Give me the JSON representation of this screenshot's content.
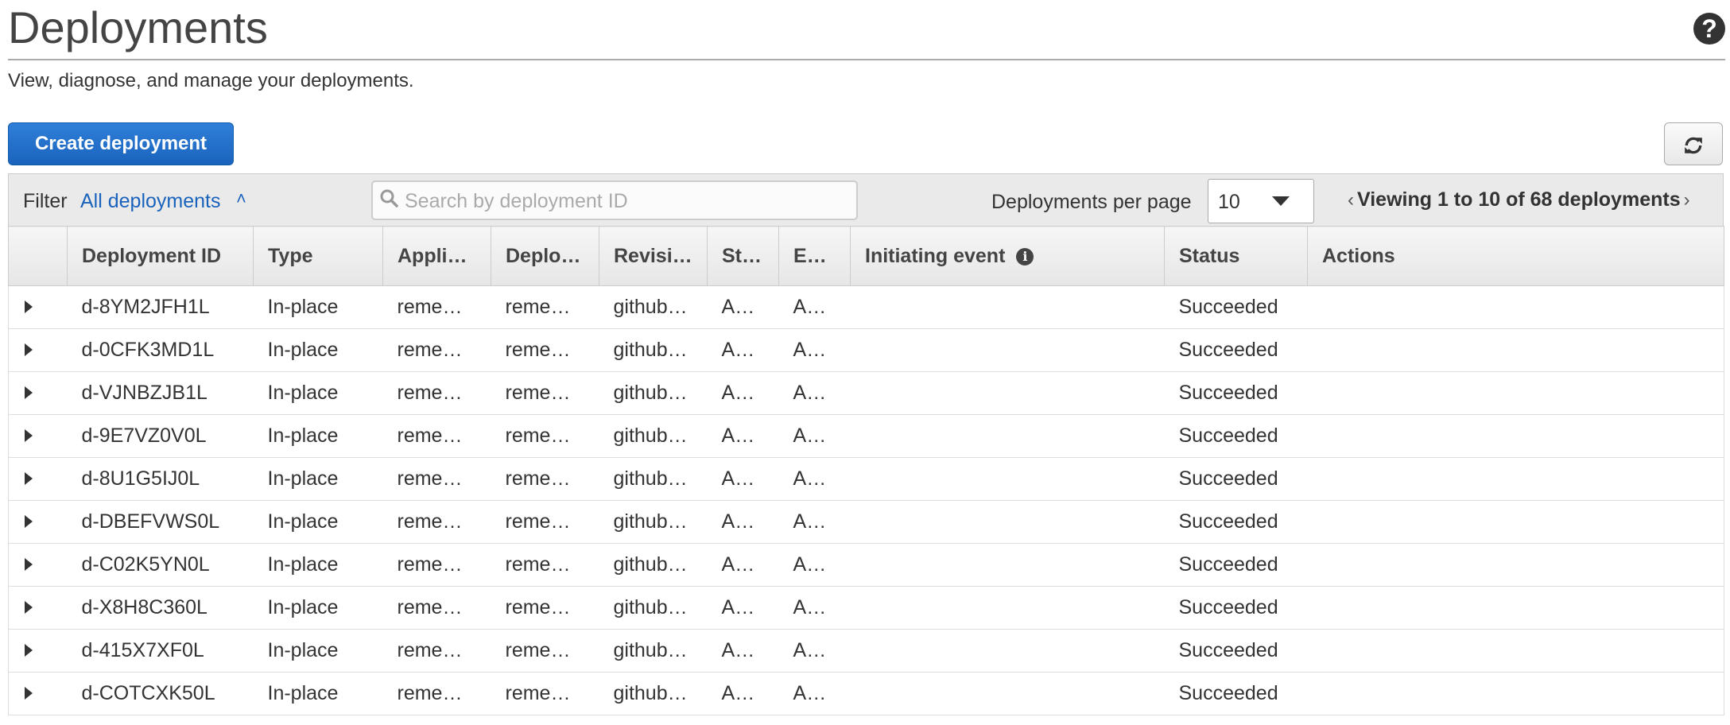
{
  "header": {
    "title": "Deployments",
    "subtitle": "View, diagnose, and manage your deployments.",
    "help_icon": "question-circle-icon"
  },
  "toolbar": {
    "create_label": "Create deployment",
    "refresh_icon": "refresh-icon"
  },
  "filter": {
    "label": "Filter",
    "value": "All deployments",
    "search_placeholder": "Search by deployment ID",
    "per_page_label": "Deployments per page",
    "per_page_value": "10",
    "pager_text": "Viewing 1 to 10 of 68 deployments"
  },
  "table": {
    "columns": [
      "Deployment ID",
      "Type",
      "Applic…",
      "Deplo…",
      "Revisi…",
      "St…",
      "En…",
      "Initiating event",
      "Status",
      "Actions"
    ],
    "rows": [
      {
        "id": "d-8YM2JFH1L",
        "type": "In-place",
        "app": "remem…",
        "group": "remem…",
        "revision": "github:…",
        "start": "Ap…",
        "end": "Ap…",
        "event": "",
        "status": "Succeeded",
        "actions": ""
      },
      {
        "id": "d-0CFK3MD1L",
        "type": "In-place",
        "app": "remem…",
        "group": "remem…",
        "revision": "github:…",
        "start": "Ap…",
        "end": "Ap…",
        "event": "",
        "status": "Succeeded",
        "actions": ""
      },
      {
        "id": "d-VJNBZJB1L",
        "type": "In-place",
        "app": "remem…",
        "group": "remem…",
        "revision": "github:…",
        "start": "Ap…",
        "end": "Ap…",
        "event": "",
        "status": "Succeeded",
        "actions": ""
      },
      {
        "id": "d-9E7VZ0V0L",
        "type": "In-place",
        "app": "remem…",
        "group": "remem…",
        "revision": "github:…",
        "start": "Ap…",
        "end": "Ap…",
        "event": "",
        "status": "Succeeded",
        "actions": ""
      },
      {
        "id": "d-8U1G5IJ0L",
        "type": "In-place",
        "app": "remem…",
        "group": "remem…",
        "revision": "github:…",
        "start": "Ap…",
        "end": "Ap…",
        "event": "",
        "status": "Succeeded",
        "actions": ""
      },
      {
        "id": "d-DBEFVWS0L",
        "type": "In-place",
        "app": "remem…",
        "group": "remem…",
        "revision": "github:…",
        "start": "Ap…",
        "end": "Ap…",
        "event": "",
        "status": "Succeeded",
        "actions": ""
      },
      {
        "id": "d-C02K5YN0L",
        "type": "In-place",
        "app": "remem…",
        "group": "remem…",
        "revision": "github:…",
        "start": "Ap…",
        "end": "Ap…",
        "event": "",
        "status": "Succeeded",
        "actions": ""
      },
      {
        "id": "d-X8H8C360L",
        "type": "In-place",
        "app": "remem…",
        "group": "remem…",
        "revision": "github:…",
        "start": "Ap…",
        "end": "Ap…",
        "event": "",
        "status": "Succeeded",
        "actions": ""
      },
      {
        "id": "d-415X7XF0L",
        "type": "In-place",
        "app": "remem…",
        "group": "remem…",
        "revision": "github:…",
        "start": "Ap…",
        "end": "Ap…",
        "event": "",
        "status": "Succeeded",
        "actions": ""
      },
      {
        "id": "d-COTCXK50L",
        "type": "In-place",
        "app": "remem…",
        "group": "remem…",
        "revision": "github:…",
        "start": "Ap…",
        "end": "Ap…",
        "event": "",
        "status": "Succeeded",
        "actions": ""
      }
    ]
  },
  "colors": {
    "link": "#1a63bd",
    "success": "#1d8102",
    "primary_button": "#1a63bd"
  }
}
